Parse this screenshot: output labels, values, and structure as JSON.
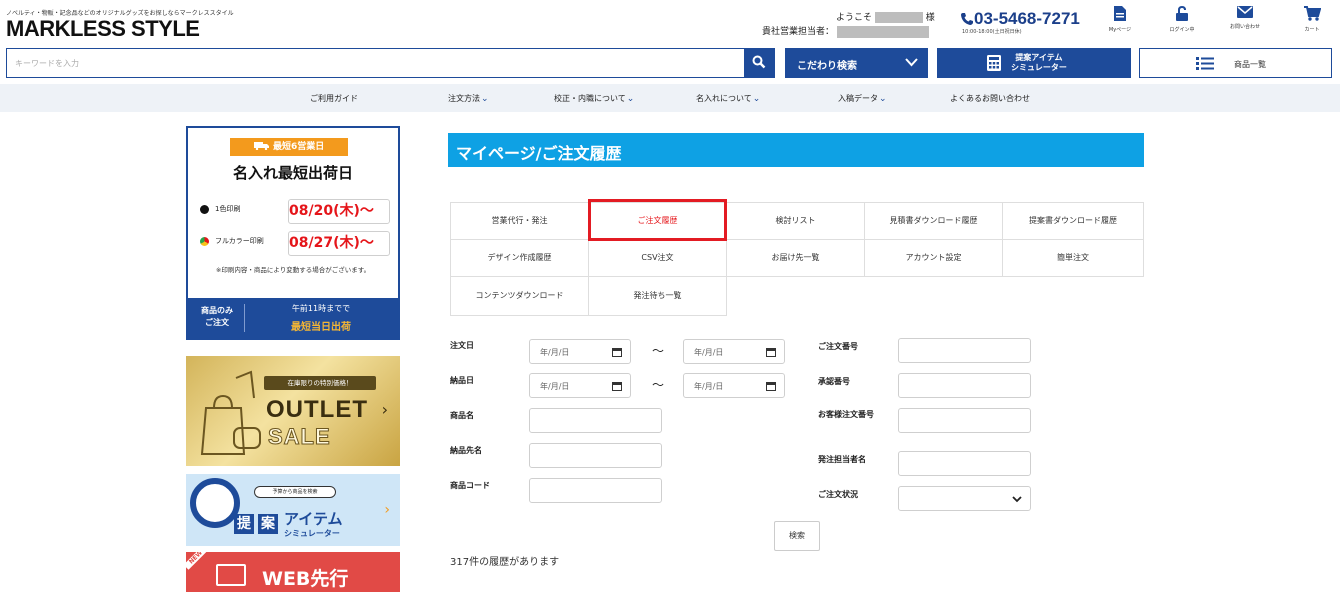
{
  "header": {
    "tagline": "ノベルティ・物販・記念品などのオリジナルグッズをお探しならマークレススタイル",
    "logo": "MARKLESS STYLE",
    "welcome_prefix": "ようこそ",
    "welcome_suffix": "様",
    "sales_rep_label": "貴社営業担当者：",
    "phone": "03-5468-7271",
    "phone_hours": "10:00-18:00(土日祝日休)",
    "icons": [
      {
        "name": "mypage",
        "label": "Myページ"
      },
      {
        "name": "login",
        "label": "ログイン中"
      },
      {
        "name": "contact",
        "label": "お問い合わせ"
      },
      {
        "name": "cart",
        "label": "カート"
      }
    ]
  },
  "search": {
    "placeholder": "キーワードを入力",
    "kodawari_label": "こだわり検索",
    "simulator_label_1": "提案アイテム",
    "simulator_label_2": "シミュレーター",
    "product_list_label": "商品一覧"
  },
  "nav": [
    {
      "label": "ご利用ガイド",
      "has_dropdown": false
    },
    {
      "label": "注文方法",
      "has_dropdown": true
    },
    {
      "label": "校正・内職について",
      "has_dropdown": true
    },
    {
      "label": "名入れについて",
      "has_dropdown": true
    },
    {
      "label": "入稿データ",
      "has_dropdown": true
    },
    {
      "label": "よくあるお問い合わせ",
      "has_dropdown": false
    }
  ],
  "sidebar": {
    "badge": "最短6営業日",
    "title": "名入れ最短出荷日",
    "rows": [
      {
        "label": "1色印刷",
        "date": "08/20(木)〜"
      },
      {
        "label": "フルカラー印刷",
        "date": "08/27(木)〜"
      }
    ],
    "note": "※印刷内容・商品により変動する場合がございます。",
    "foot_left_1": "商品のみ",
    "foot_left_2": "ご注文",
    "foot_right_1": "午前11時までで",
    "foot_right_2": "最短当日出荷",
    "outlet_tag": "在庫限りの特別価格！",
    "outlet_word_1": "OUTLET",
    "outlet_word_2": "SALE",
    "teian_bubble": "予算から商品を検索",
    "teian_k1": "提",
    "teian_k2": "案",
    "teian_t1": "アイテム",
    "teian_t2": "シミュレーター",
    "web_new": "NEW",
    "web_title": "WEB先行"
  },
  "main": {
    "title": "マイページ/ご注文履歴",
    "tabs": [
      {
        "label": "営業代行・発注",
        "active": false
      },
      {
        "label": "ご注文履歴",
        "active": true
      },
      {
        "label": "検討リスト",
        "active": false
      },
      {
        "label": "見積書ダウンロード履歴",
        "active": false
      },
      {
        "label": "提案書ダウンロード履歴",
        "active": false
      },
      {
        "label": "デザイン作成履歴",
        "active": false
      },
      {
        "label": "CSV注文",
        "active": false
      },
      {
        "label": "お届け先一覧",
        "active": false
      },
      {
        "label": "アカウント設定",
        "active": false
      },
      {
        "label": "簡単注文",
        "active": false
      },
      {
        "label": "コンテンツダウンロード",
        "active": false
      },
      {
        "label": "発注待ち一覧",
        "active": false
      }
    ],
    "form": {
      "order_date": "注文日",
      "delivery_date": "納品日",
      "product_name": "商品名",
      "delivery_name": "納品先名",
      "product_code": "商品コード",
      "order_no": "ご注文番号",
      "approval_no": "承認番号",
      "customer_order_no": "お客様注文番号",
      "order_person": "発注担当者名",
      "order_status": "ご注文状況",
      "date_placeholder": "年/月/日",
      "tilde": "〜"
    },
    "search_button": "検索",
    "result_count": "317件の履歴があります"
  },
  "colors": {
    "brand": "#1e4b9a",
    "title_bar": "#0ea1e4",
    "highlight": "#e31b23",
    "accent_orange": "#f39a1d",
    "date_red": "#e5151a"
  }
}
